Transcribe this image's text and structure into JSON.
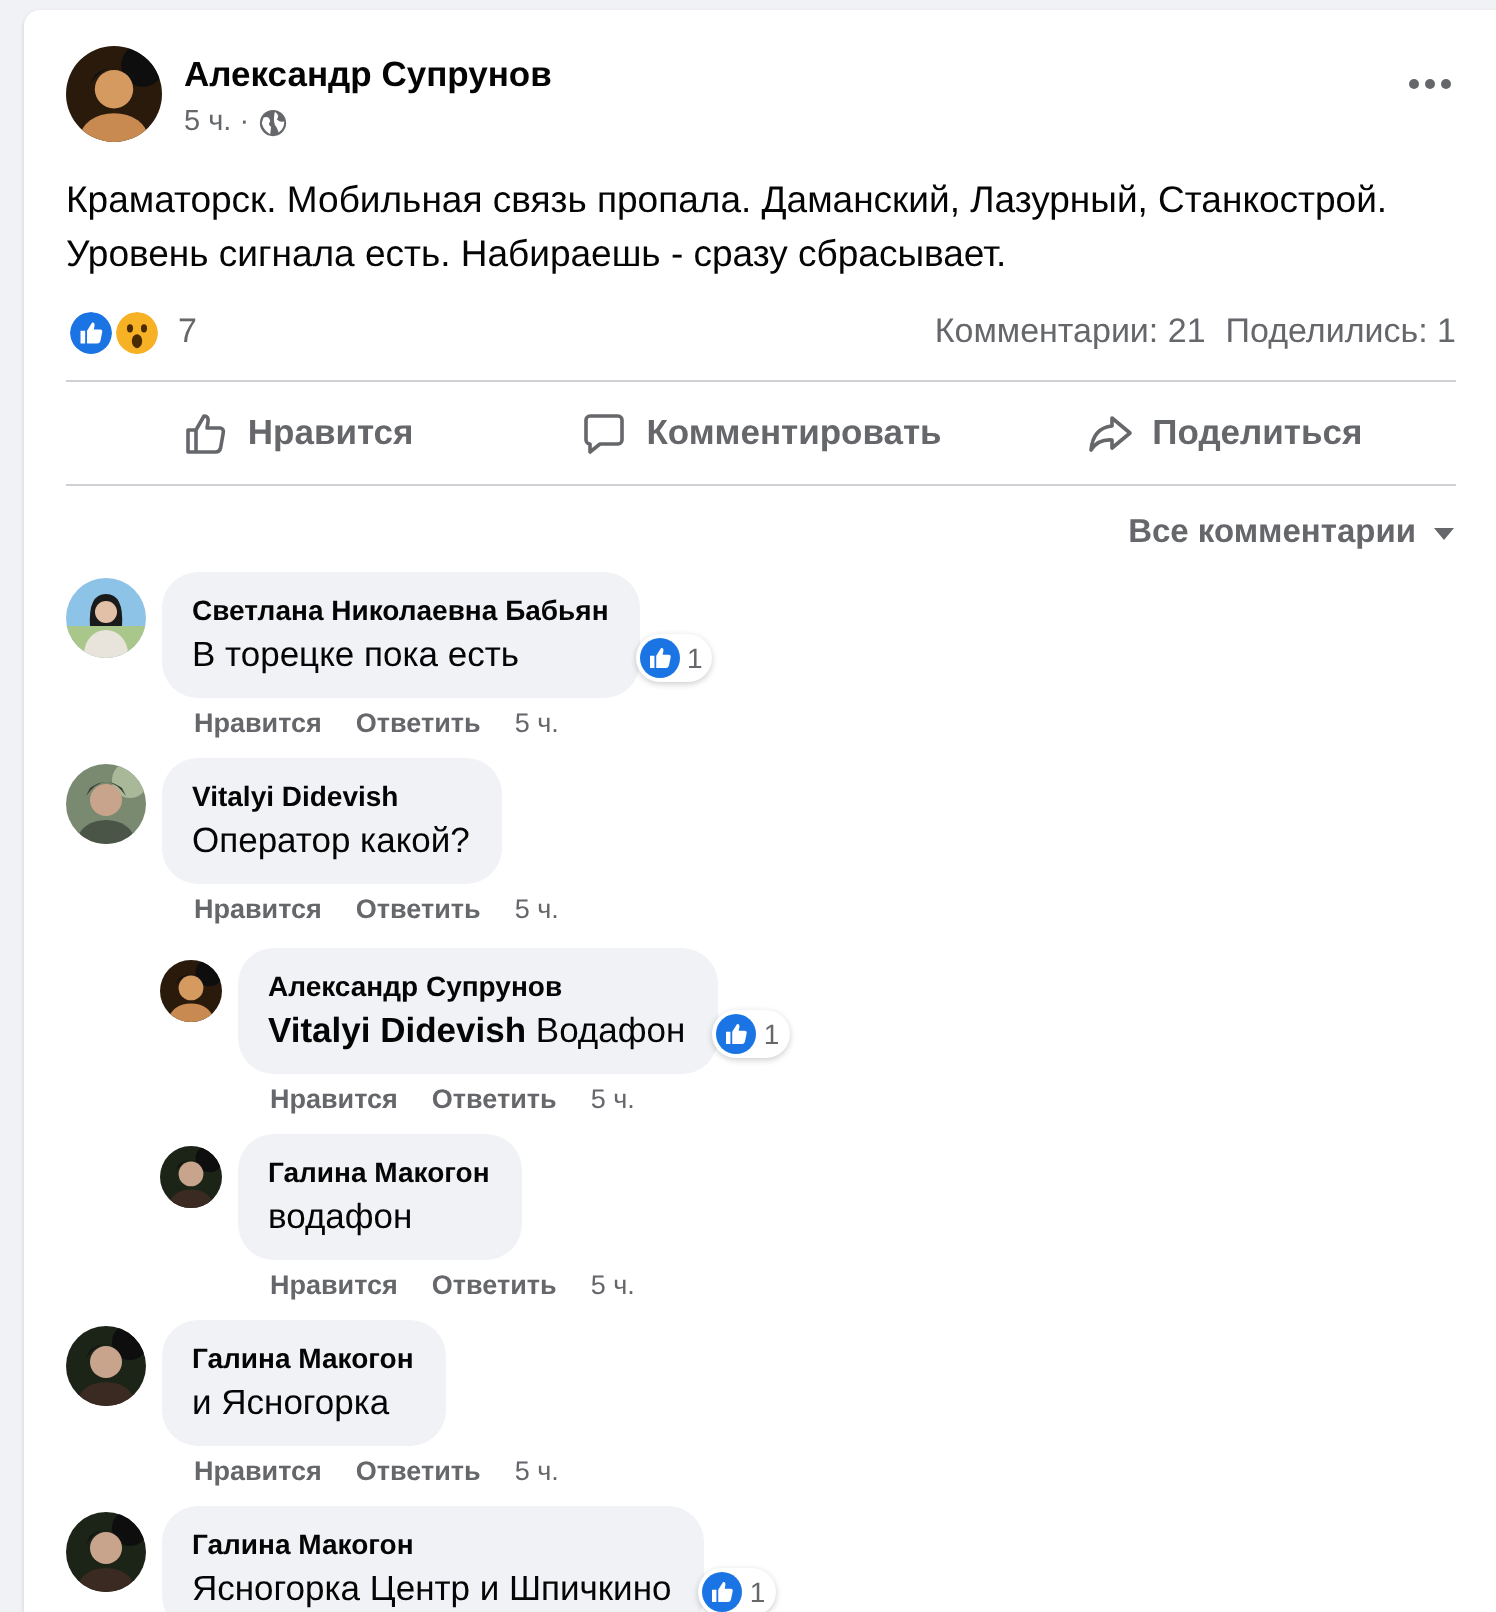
{
  "post": {
    "author": "Александр Супрунов",
    "time": "5 ч.",
    "separator": "·",
    "text": "Краматорск. Мобильная связь пропала. Даманский, Лазурный, Станкострой.\nУровень сигнала есть. Набираешь - сразу сбрасывает.",
    "reactions": [
      {
        "kind": "like"
      },
      {
        "kind": "wow"
      }
    ],
    "reaction_count": "7",
    "comments_count": "Комментарии: 21",
    "shares_count": "Поделились: 1"
  },
  "actions": [
    {
      "kind": "like",
      "label": "Нравится"
    },
    {
      "kind": "comment",
      "label": "Комментировать"
    },
    {
      "kind": "share",
      "label": "Поделиться"
    }
  ],
  "filter": {
    "label": "Все комментарии"
  },
  "comments": [
    {
      "author": "Светлана Николаевна Бабьян",
      "text": "В торецке пока есть",
      "reaction": {
        "kind": "like",
        "count": "1"
      },
      "like": "Нравится",
      "reply": "Ответить",
      "time": "5 ч."
    },
    {
      "author": "Vitalyi Didevish",
      "text": "Оператор какой?",
      "like": "Нравится",
      "reply": "Ответить",
      "time": "5 ч.",
      "children": [
        {
          "author": "Александр Супрунов",
          "text": "**Vitalyi Didevish** Водафон",
          "reaction": {
            "kind": "like",
            "count": "1"
          },
          "like": "Нравится",
          "reply": "Ответить",
          "time": "5 ч."
        },
        {
          "author": "Галина Макогон",
          "text": "водафон",
          "like": "Нравится",
          "reply": "Ответить",
          "time": "5 ч."
        }
      ]
    },
    {
      "author": "Галина Макогон",
      "text": "и Ясногорка",
      "like": "Нравится",
      "reply": "Ответить",
      "time": "5 ч."
    },
    {
      "author": "Галина Макогон",
      "text": "Ясногорка Центр и Шпичкино",
      "reaction": {
        "kind": "like",
        "count": "1"
      }
    }
  ]
}
